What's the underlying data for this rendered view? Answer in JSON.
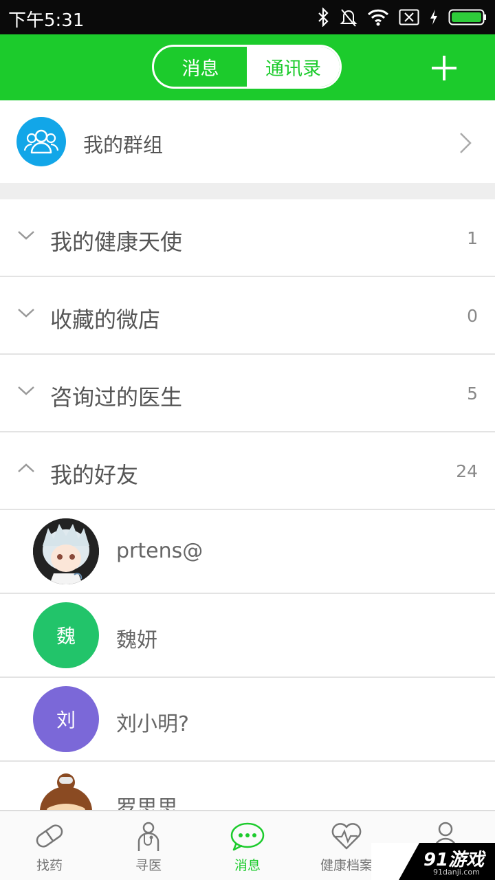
{
  "status_bar": {
    "time": "下午5:31"
  },
  "header": {
    "tabs": [
      {
        "label": "消息",
        "active": false
      },
      {
        "label": "通讯录",
        "active": true
      }
    ],
    "add_icon": "plus-icon"
  },
  "groups": {
    "label": "我的群组",
    "icon": "group-icon"
  },
  "categories": [
    {
      "label": "我的健康天使",
      "count": "1",
      "expanded": false
    },
    {
      "label": "收藏的微店",
      "count": "0",
      "expanded": false
    },
    {
      "label": "咨询过的医生",
      "count": "5",
      "expanded": false
    },
    {
      "label": "我的好友",
      "count": "24",
      "expanded": true
    }
  ],
  "friends": [
    {
      "name": "prtens@",
      "avatar_type": "photo",
      "avatar_text": ""
    },
    {
      "name": "魏妍",
      "avatar_type": "initial",
      "avatar_text": "魏",
      "avatar_color": "#22c46a"
    },
    {
      "name": "刘小明?",
      "avatar_type": "initial",
      "avatar_text": "刘",
      "avatar_color": "#7b68d8"
    },
    {
      "name": "罗思思",
      "avatar_type": "photo",
      "avatar_text": ""
    }
  ],
  "tab_bar": {
    "items": [
      {
        "label": "找药",
        "icon": "pill-icon",
        "active": false
      },
      {
        "label": "寻医",
        "icon": "stethoscope-icon",
        "active": false
      },
      {
        "label": "消息",
        "icon": "chat-bubble-icon",
        "active": true
      },
      {
        "label": "健康档案",
        "icon": "heart-pulse-icon",
        "active": false
      },
      {
        "label": "",
        "icon": "person-icon",
        "active": false
      }
    ]
  },
  "watermark": {
    "main": "91游戏",
    "sub": "91danji.com"
  },
  "colors": {
    "accent": "#1ccb2c",
    "group_blue": "#12a6e8"
  }
}
